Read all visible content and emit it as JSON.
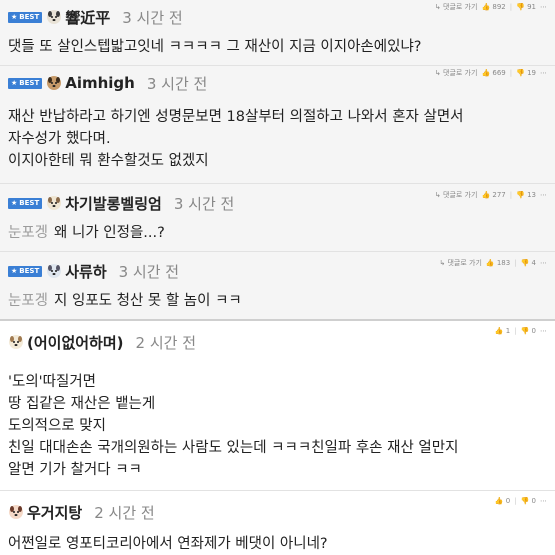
{
  "comments": [
    {
      "best": true,
      "badge": "BEST",
      "nickname": "響近平",
      "time": "3 시간 전",
      "reply": "댓글로 가기",
      "likes": "892",
      "dislikes": "91",
      "lines": [
        "댓들 또 살인스텝밟고잇네 ㅋㅋㅋㅋ 그 재산이 지금 이지아손에있냐?"
      ]
    },
    {
      "best": true,
      "badge": "BEST",
      "nickname": "Aimhigh",
      "time": "3 시간 전",
      "reply": "댓글로 가기",
      "likes": "669",
      "dislikes": "19",
      "lines": [
        "재산 반납하라고 하기엔 성명문보면 18살부터 의절하고 나와서 혼자 살면서",
        "자수성가 했다며.",
        "이지아한테 뭐 환수할것도 없겠지"
      ]
    },
    {
      "best": true,
      "badge": "BEST",
      "nickname": "차기발롱벨링엄",
      "time": "3 시간 전",
      "reply": "댓글로 가기",
      "likes": "277",
      "dislikes": "13",
      "hidden_tag": "눈포겡",
      "text": "왜 니가 인정을...?"
    },
    {
      "best": true,
      "badge": "BEST",
      "nickname": "사류하",
      "time": "3 시간 전",
      "reply": "댓글로 가기",
      "likes": "183",
      "dislikes": "4",
      "hidden_tag": "눈포겡",
      "text": "지 잉포도 청산 못 할 놈이 ㅋㅋ"
    },
    {
      "best": false,
      "nickname": "(어이없어하며)",
      "time": "2 시간 전",
      "likes": "1",
      "dislikes": "0",
      "lines": [
        "'도의'따질거면",
        "땅 집같은 재산은 뱉는게",
        "도의적으로 맞지",
        "친일 대대손손 국개의원하는 사람도 있는데 ㅋㅋㅋ친일파 후손 재산 얼만지",
        "알면 기가 찰거다 ㅋㅋ"
      ]
    },
    {
      "best": false,
      "nickname": "우거지탕",
      "time": "2 시간 전",
      "likes": "0",
      "dislikes": "0",
      "lines": [
        "어쩐일로 영포티코리아에서 연좌제가 베댓이 아니네?"
      ]
    }
  ],
  "colors": {
    "best_badge": "#3a7fd5",
    "best_bg": "#f5f5f5",
    "time": "#888888",
    "hidden_tag": "#9b9b9b"
  },
  "icons": {
    "star": "star-icon",
    "reply": "reply-arrow-icon",
    "like": "thumbs-up-icon",
    "dislike": "thumbs-down-icon",
    "avatar": "dog-avatar-icon"
  }
}
